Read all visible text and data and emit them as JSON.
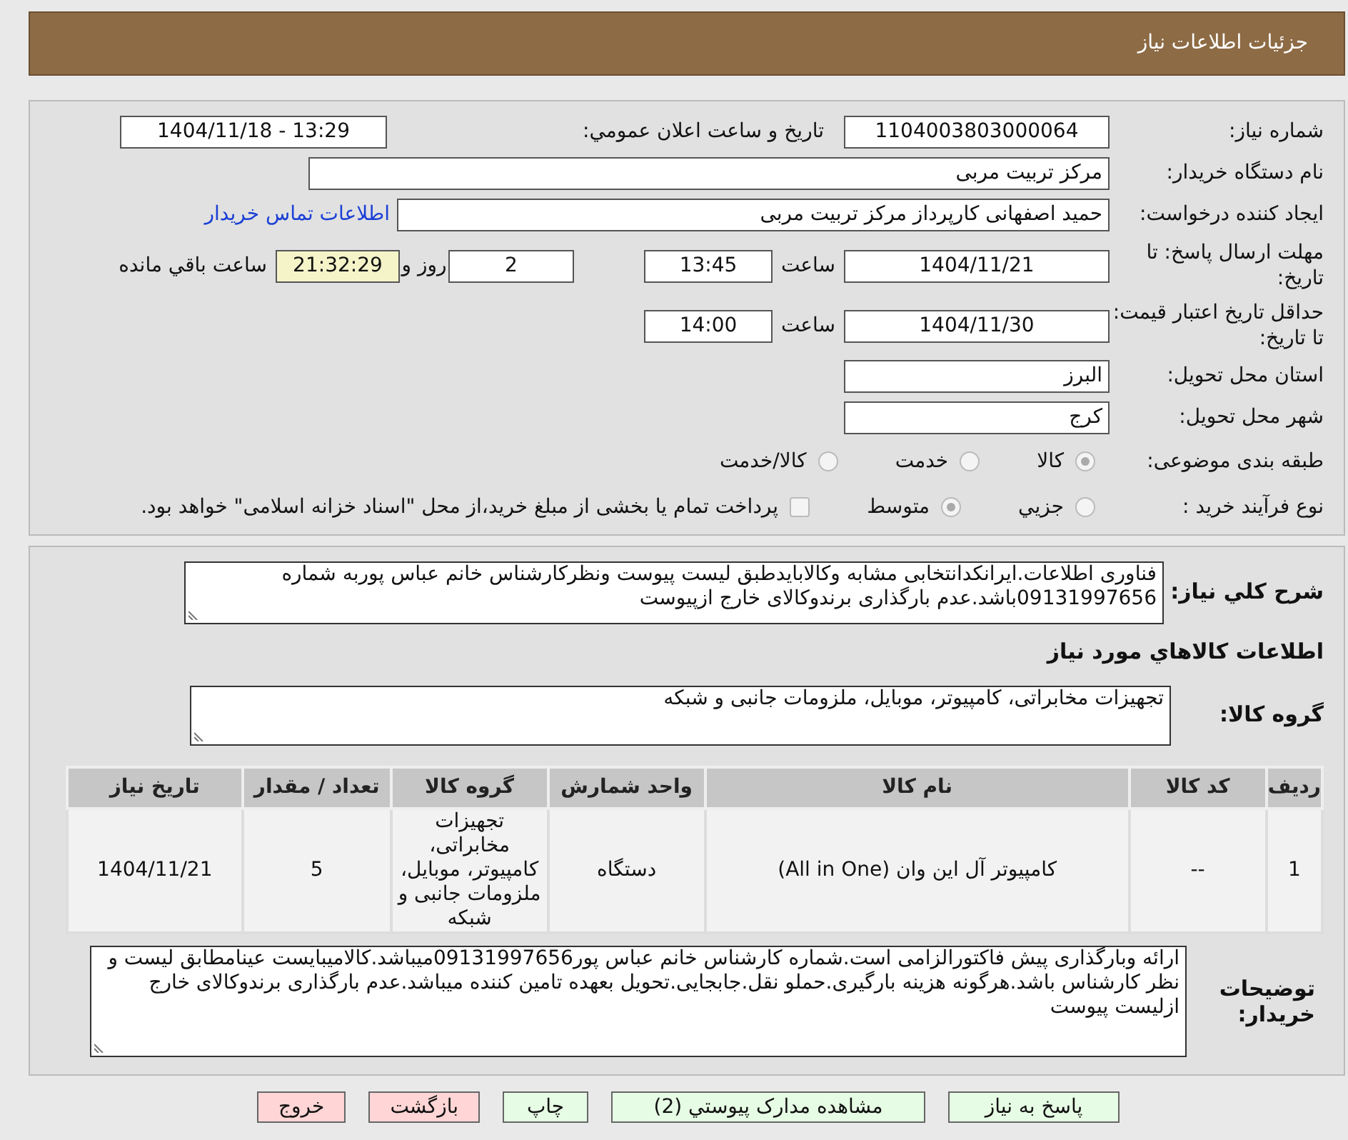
{
  "header": {
    "title": "جزئیات اطلاعات نیاز"
  },
  "need_number": {
    "label": "شماره نیاز:",
    "value": "1104003803000064"
  },
  "announce": {
    "label": "تاریخ و ساعت اعلان عمومي:",
    "value": "1404/11/18 - 13:29"
  },
  "buyer": {
    "label": "نام دستگاه خریدار:",
    "value": "مرکز تربیت مربی"
  },
  "requester": {
    "label": "ایجاد کننده درخواست:",
    "value": "حمید اصفهانی کارپرداز مرکز تربیت مربی",
    "link": "اطلاعات تماس خریدار"
  },
  "deadline": {
    "label": "مهلت ارسال پاسخ: تا تاریخ:",
    "date": "1404/11/21",
    "time_label": "ساعت",
    "time": "13:45",
    "days": "2",
    "days_label": "روز و",
    "remaining": "21:32:29",
    "remaining_label": "ساعت باقي مانده"
  },
  "validity": {
    "label": "حداقل تاریخ اعتبار قیمت: تا تاریخ:",
    "date": "1404/11/30",
    "time_label": "ساعت",
    "time": "14:00"
  },
  "province": {
    "label": "استان محل تحویل:",
    "value": "البرز"
  },
  "city": {
    "label": "شهر محل تحویل:",
    "value": "کرج"
  },
  "category": {
    "label": "طبقه بندی موضوعی:",
    "options": [
      {
        "label": "کالا",
        "selected": true
      },
      {
        "label": "خدمت",
        "selected": false
      },
      {
        "label": "کالا/خدمت",
        "selected": false
      }
    ]
  },
  "process": {
    "label": "نوع فرآیند خرید :",
    "options": [
      {
        "label": "جزيي",
        "selected": false
      },
      {
        "label": "متوسط",
        "selected": true
      }
    ],
    "payment": {
      "checked": false,
      "text": "پرداخت تمام یا بخشی از مبلغ خرید،از محل \"اسناد خزانه اسلامی\" خواهد بود."
    }
  },
  "description": {
    "label": "شرح کلي نیاز:",
    "value": "فناوری اطلاعات.ایرانکدانتخابی مشابه وکالابایدطبق لیست پیوست ونظرکارشناس خانم عباس پوربه شماره 09131997656باشد.عدم بارگذاری برندوکالای خارج ازپیوست"
  },
  "goods_heading": "اطلاعات كالاهاي مورد نیاز",
  "goods_group": {
    "label": "گروه کالا:",
    "value": "تجهیزات مخابراتی، کامپیوتر، موبایل، ملزومات جانبی و شبکه"
  },
  "table": {
    "columns": [
      "ردیف",
      "کد کالا",
      "نام کالا",
      "واحد شمارش",
      "گروه کالا",
      "تعداد / مقدار",
      "تاریخ نیاز"
    ],
    "rows": [
      [
        "1",
        "--",
        "کامپیوتر آل این وان (All in One)",
        "دستگاه",
        "تجهیزات مخابراتی، کامپیوتر، موبایل، ملزومات جانبی و شبکه",
        "5",
        "1404/11/21"
      ]
    ]
  },
  "buyer_notes": {
    "label": "توضیحات خریدار:",
    "value": "ارائه وبارگذاری پیش فاکتورالزامی است.شماره کارشناس خانم عباس پور09131997656میباشد.کالامیبایست عینامطابق لیست و نظر کارشناس باشد.هرگونه هزینه بارگیری.حملو نقل.جابجایی.تحویل بعهده تامین کننده میباشد.عدم بارگذاری برندوکالای خارج ازلیست پیوست"
  },
  "buttons": [
    {
      "label": "پاسخ به نیاز",
      "kind": "action"
    },
    {
      "label": "مشاهده مدارک پیوستي (2)",
      "kind": "action"
    },
    {
      "label": "چاپ",
      "kind": "action"
    },
    {
      "label": "بازگشت",
      "kind": "exit"
    },
    {
      "label": "خروج",
      "kind": "exit"
    }
  ]
}
